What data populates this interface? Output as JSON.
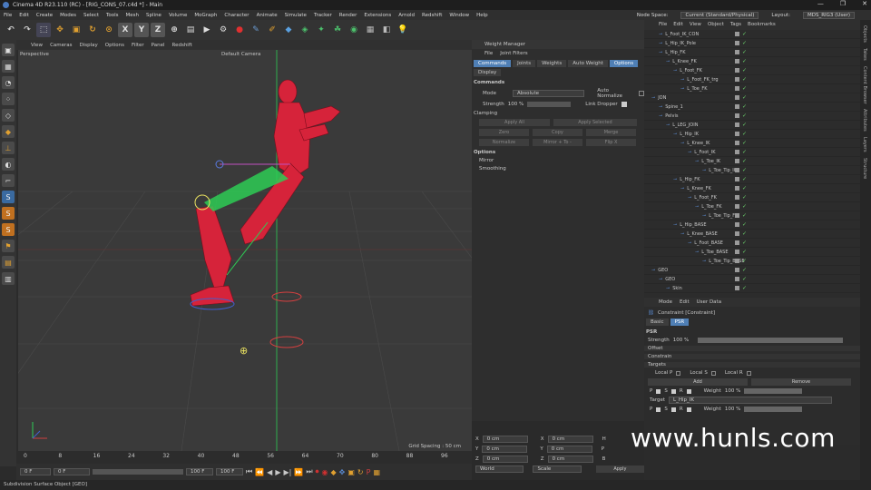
{
  "window": {
    "title": "Cinema 4D R23.110 (RC) - [RIG_CONS_07.c4d *] - Main",
    "controls": [
      "—",
      "❐",
      "✕"
    ]
  },
  "menu": [
    "File",
    "Edit",
    "Create",
    "Modes",
    "Select",
    "Tools",
    "Mesh",
    "Spline",
    "Volume",
    "MoGraph",
    "Character",
    "Animate",
    "Simulate",
    "Tracker",
    "Render",
    "Extensions",
    "Arnold",
    "Redshift",
    "Window",
    "Help"
  ],
  "node_space_label": "Node Space:",
  "node_space_value": "Current (Standard/Physical)",
  "layout_label": "Layout:",
  "layout_value": "MDS_RIG3 (User)",
  "viewport": {
    "menu": [
      "View",
      "Cameras",
      "Display",
      "Options",
      "Filter",
      "Panel",
      "Redshift"
    ],
    "name": "Perspective",
    "camera": "Default Camera",
    "grid_spacing": "Grid Spacing : 50 cm"
  },
  "timeline": {
    "ticks": [
      "0",
      "8",
      "16",
      "24",
      "32",
      "40",
      "48",
      "56",
      "64",
      "70",
      "80",
      "88",
      "96"
    ],
    "current_frame_value": "0 F",
    "start_value": "0 F",
    "end_value": "100 F",
    "end2_value": "100 F",
    "frame_display": "0 F"
  },
  "weight_manager": {
    "title": "Weight Manager",
    "menu": [
      "File",
      "Joint Filters"
    ],
    "tabs": [
      "Commands",
      "Joints",
      "Weights",
      "Auto Weight",
      "Options"
    ],
    "display_tab": "Display",
    "commands_title": "Commands",
    "mode_label": "Mode",
    "mode_value": "Absolute",
    "auto_normalize": "Auto Normalize",
    "strength_label": "Strength",
    "strength_value": "100 %",
    "link_dropper": "Link Dropper",
    "clamping": "Clamping",
    "apply_all": "Apply All",
    "apply_selected": "Apply Selected",
    "zero": "Zero",
    "copy": "Copy",
    "merge": "Merge",
    "normalize": "Normalize",
    "mirror": "Mirror + To -",
    "flip": "Flip X",
    "options": "Options",
    "mirror_sub": "Mirror",
    "smoothing": "Smoothing"
  },
  "coords": {
    "x": "X",
    "y": "Y",
    "z": "Z",
    "h": "H",
    "p": "P",
    "b": "B",
    "zero": "0 cm",
    "world": "World",
    "scale": "Scale",
    "apply": "Apply"
  },
  "object_manager": {
    "menu": [
      "File",
      "Edit",
      "View",
      "Object",
      "Tags",
      "Bookmarks"
    ],
    "rows": [
      {
        "name": "L_Foot_IK_CON",
        "indent": 16
      },
      {
        "name": "L_Hip_IK_Pole",
        "indent": 16
      },
      {
        "name": "L_Hip_FK",
        "indent": 16
      },
      {
        "name": "L_Knee_FK",
        "indent": 24
      },
      {
        "name": "L_Foot_FK",
        "indent": 32
      },
      {
        "name": "L_Foot_FK_trg",
        "indent": 40
      },
      {
        "name": "L_Toe_FK",
        "indent": 40
      },
      {
        "name": "JON",
        "indent": 8
      },
      {
        "name": "Spine_1",
        "indent": 16
      },
      {
        "name": "Pelvis",
        "indent": 16
      },
      {
        "name": "L_LEG_JOIN",
        "indent": 24
      },
      {
        "name": "L_Hip_IK",
        "indent": 32
      },
      {
        "name": "L_Knee_IK",
        "indent": 40
      },
      {
        "name": "L_Foot_IK",
        "indent": 48
      },
      {
        "name": "L_Toe_IK",
        "indent": 56
      },
      {
        "name": "L_Toe_Tip_IK",
        "indent": 64
      },
      {
        "name": "L_Hip_FK",
        "indent": 32
      },
      {
        "name": "L_Knee_FK",
        "indent": 40
      },
      {
        "name": "L_Foot_FK",
        "indent": 48
      },
      {
        "name": "L_Toe_FK",
        "indent": 56
      },
      {
        "name": "L_Toe_Tip_FK",
        "indent": 64
      },
      {
        "name": "L_Hip_BASE",
        "indent": 32
      },
      {
        "name": "L_Knee_BASE",
        "indent": 40
      },
      {
        "name": "L_Foot_BASE",
        "indent": 48
      },
      {
        "name": "L_Toe_BASE",
        "indent": 56
      },
      {
        "name": "L_Toe_Tip_BASE",
        "indent": 64
      },
      {
        "name": "GEO",
        "indent": 8
      },
      {
        "name": "GEO",
        "indent": 16
      },
      {
        "name": "Skin",
        "indent": 24
      }
    ]
  },
  "attributes": {
    "menu": [
      "Mode",
      "Edit",
      "User Data"
    ],
    "object": "Constraint [Constraint]",
    "tabs": [
      "Basic",
      "PSR"
    ],
    "psr": "PSR",
    "strength_label": "Strength",
    "strength_value": "100 %",
    "offset": "Offset",
    "constrain": "Constrain",
    "targets": "Targets",
    "local_p": "Local P",
    "local_s": "Local S",
    "local_r": "Local R",
    "add": "Add",
    "remove": "Remove",
    "p": "P",
    "s": "S",
    "r": "R",
    "weight_label": "Weight",
    "weight_value": "100 %",
    "target_label": "Target",
    "target_value": "L_Hip_IK"
  },
  "right_tabs": [
    "Objects",
    "Takes",
    "Content Browser",
    "Attributes",
    "Layers",
    "Structure"
  ],
  "status": "Subdivision Surface Object [GEO]",
  "watermark": "www.hunls.com",
  "colors": {
    "accent": "#4f7fb5",
    "mesh": "#d6233a",
    "bone": "#2ecc55"
  }
}
